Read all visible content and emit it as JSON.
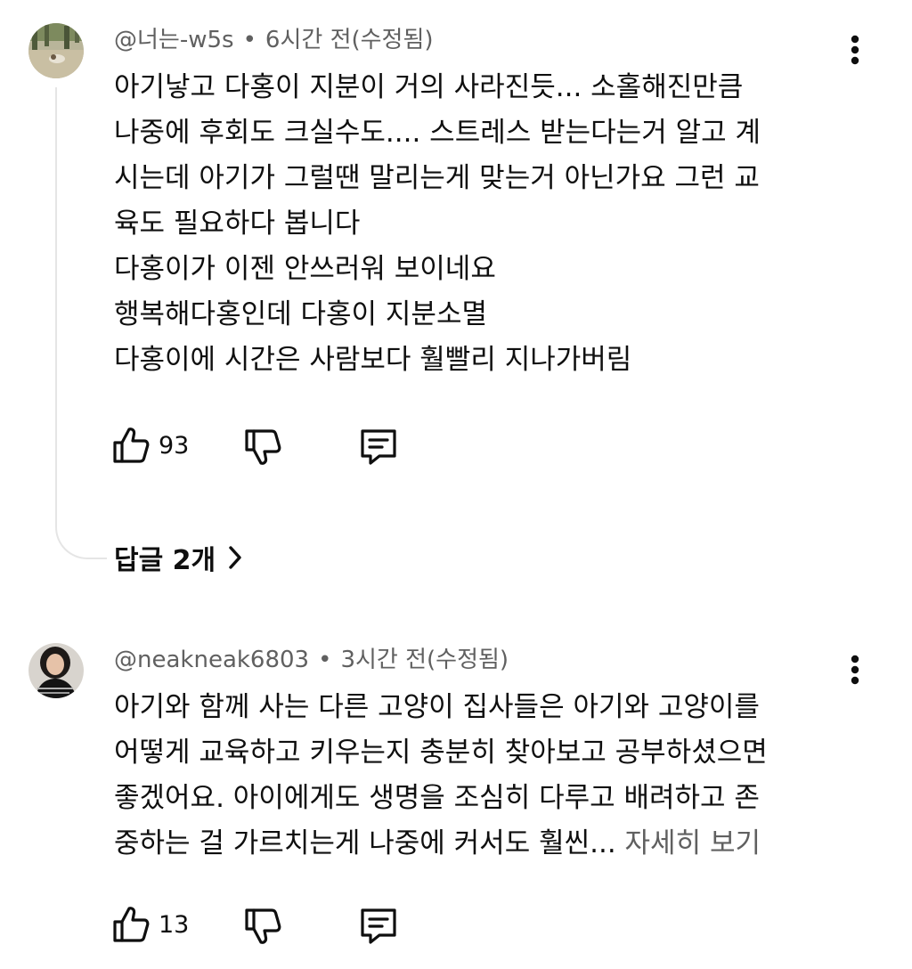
{
  "comments": [
    {
      "author": "@너는-w5s",
      "separator": "•",
      "time": "6시간 전(수정됨)",
      "lines": [
        "아기낳고 다홍이 지분이 거의 사라진듯...   소홀해진만큼",
        "나중에 후회도 크실수도....  스트레스 받는다는거 알고 계",
        "시는데 아기가 그럴땐 말리는게 맞는거 아닌가요 그런 교",
        "육도 필요하다 봅니다",
        "다홍이가 이젠 안쓰러워 보이네요",
        "행복해다홍인데 다홍이 지분소멸",
        "다홍이에 시간은 사람보다 훨빨리 지나가버림"
      ],
      "like_count": "93",
      "icons": {
        "like": "thumbs-up-icon",
        "dislike": "thumbs-down-icon",
        "reply": "comment-icon",
        "more": "more-vertical-icon",
        "avatar": "park-photo-avatar"
      },
      "replies_label": "답글 2개"
    },
    {
      "author": "@neakneak6803",
      "separator": "•",
      "time": "3시간 전(수정됨)",
      "lines": [
        "아기와 함께 사는 다른 고양이 집사들은 아기와 고양이를",
        "어떻게 교육하고 키우는지 충분히 찾아보고 공부하셨으면",
        "좋겠어요. 아이에게도 생명을 조심히 다루고 배려하고 존"
      ],
      "last_line": "중하는 걸 가르치는게 나중에 커서도 훨씬...",
      "see_more": "자세히 보기",
      "like_count": "13",
      "icons": {
        "like": "thumbs-up-icon",
        "dislike": "thumbs-down-icon",
        "reply": "comment-icon",
        "more": "more-vertical-icon",
        "avatar": "woman-portrait-avatar"
      }
    }
  ],
  "colors": {
    "text": "#0f0f0f",
    "secondary": "#606060",
    "thread_line": "#e5e5e5",
    "background": "#ffffff"
  }
}
